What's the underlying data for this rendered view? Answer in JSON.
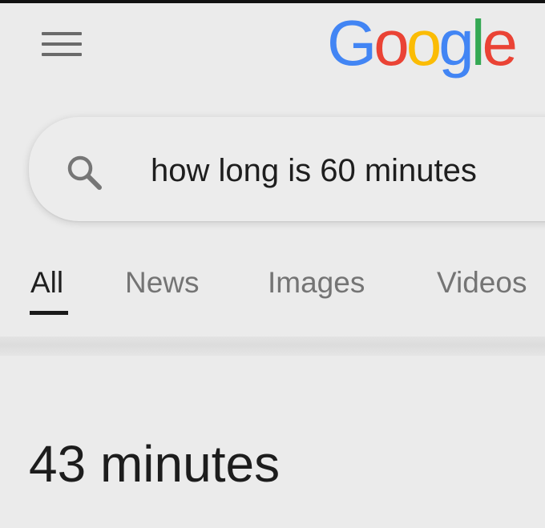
{
  "header": {
    "logo": {
      "text": "Google",
      "letters": [
        {
          "char": "G",
          "color": "#4285F4"
        },
        {
          "char": "o",
          "color": "#EA4335"
        },
        {
          "char": "o",
          "color": "#FBBC05"
        },
        {
          "char": "g",
          "color": "#4285F4"
        },
        {
          "char": "l",
          "color": "#34A853"
        },
        {
          "char": "e",
          "color": "#EA4335"
        }
      ]
    },
    "menu_icon": "hamburger-menu-icon"
  },
  "search": {
    "query": "how long is 60 minutes",
    "icon": "search-icon"
  },
  "tabs": [
    {
      "label": "All",
      "active": true
    },
    {
      "label": "News",
      "active": false
    },
    {
      "label": "Images",
      "active": false
    },
    {
      "label": "Videos",
      "active": false
    }
  ],
  "result": {
    "answer": "43 minutes"
  },
  "colors": {
    "background": "#ebebeb",
    "text_primary": "#1f1f1f",
    "text_secondary": "#747474",
    "icon_gray": "#6a6a6a"
  }
}
